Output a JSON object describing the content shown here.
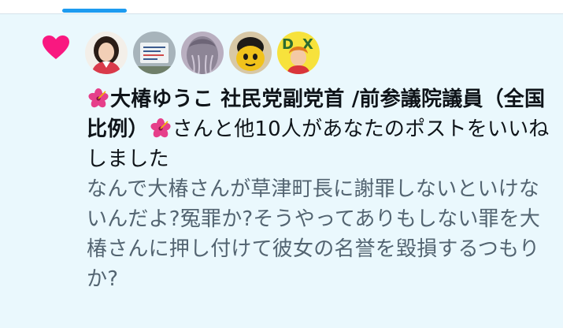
{
  "header": {
    "active_tab": "notifications"
  },
  "notification": {
    "icon": "heart-icon",
    "icon_color": "#f91880",
    "avatars": [
      {
        "name": "avatar-woman-portrait"
      },
      {
        "name": "avatar-sign-photo"
      },
      {
        "name": "avatar-gray-hair"
      },
      {
        "name": "avatar-yellow-character"
      },
      {
        "name": "avatar-dx-character"
      }
    ],
    "sender_prefix_emoji": "hibiscus-icon",
    "sender_name": "大椿ゆうこ 社民党副党首 /前参議院議員（全国比例）",
    "sender_suffix_emoji": "hibiscus-icon",
    "action_text": "さんと他10人があなたのポストをいいねしました",
    "post_text": "なんで大椿さんが草津町長に謝罪しないといけないんだよ?冤罪か?そうやってありもしない罪を大椿さんに押し付けて彼女の名誉を毀損するつもりか?"
  },
  "colors": {
    "background": "#eaf8fd",
    "accent": "#1d9bf0",
    "like": "#f91880",
    "muted_text": "#536471"
  }
}
